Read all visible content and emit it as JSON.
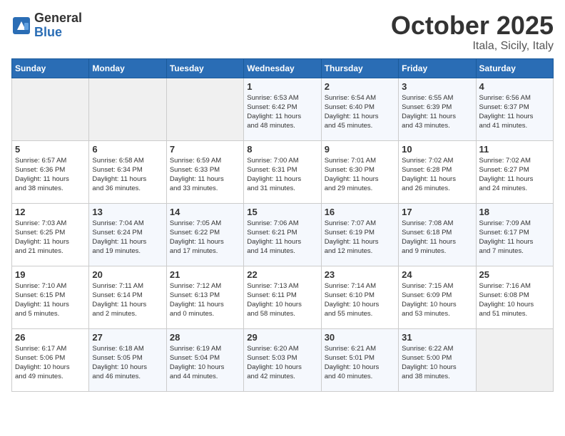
{
  "logo": {
    "general": "General",
    "blue": "Blue"
  },
  "title": "October 2025",
  "subtitle": "Itala, Sicily, Italy",
  "days_header": [
    "Sunday",
    "Monday",
    "Tuesday",
    "Wednesday",
    "Thursday",
    "Friday",
    "Saturday"
  ],
  "weeks": [
    [
      {
        "day": "",
        "info": ""
      },
      {
        "day": "",
        "info": ""
      },
      {
        "day": "",
        "info": ""
      },
      {
        "day": "1",
        "info": "Sunrise: 6:53 AM\nSunset: 6:42 PM\nDaylight: 11 hours\nand 48 minutes."
      },
      {
        "day": "2",
        "info": "Sunrise: 6:54 AM\nSunset: 6:40 PM\nDaylight: 11 hours\nand 45 minutes."
      },
      {
        "day": "3",
        "info": "Sunrise: 6:55 AM\nSunset: 6:39 PM\nDaylight: 11 hours\nand 43 minutes."
      },
      {
        "day": "4",
        "info": "Sunrise: 6:56 AM\nSunset: 6:37 PM\nDaylight: 11 hours\nand 41 minutes."
      }
    ],
    [
      {
        "day": "5",
        "info": "Sunrise: 6:57 AM\nSunset: 6:36 PM\nDaylight: 11 hours\nand 38 minutes."
      },
      {
        "day": "6",
        "info": "Sunrise: 6:58 AM\nSunset: 6:34 PM\nDaylight: 11 hours\nand 36 minutes."
      },
      {
        "day": "7",
        "info": "Sunrise: 6:59 AM\nSunset: 6:33 PM\nDaylight: 11 hours\nand 33 minutes."
      },
      {
        "day": "8",
        "info": "Sunrise: 7:00 AM\nSunset: 6:31 PM\nDaylight: 11 hours\nand 31 minutes."
      },
      {
        "day": "9",
        "info": "Sunrise: 7:01 AM\nSunset: 6:30 PM\nDaylight: 11 hours\nand 29 minutes."
      },
      {
        "day": "10",
        "info": "Sunrise: 7:02 AM\nSunset: 6:28 PM\nDaylight: 11 hours\nand 26 minutes."
      },
      {
        "day": "11",
        "info": "Sunrise: 7:02 AM\nSunset: 6:27 PM\nDaylight: 11 hours\nand 24 minutes."
      }
    ],
    [
      {
        "day": "12",
        "info": "Sunrise: 7:03 AM\nSunset: 6:25 PM\nDaylight: 11 hours\nand 21 minutes."
      },
      {
        "day": "13",
        "info": "Sunrise: 7:04 AM\nSunset: 6:24 PM\nDaylight: 11 hours\nand 19 minutes."
      },
      {
        "day": "14",
        "info": "Sunrise: 7:05 AM\nSunset: 6:22 PM\nDaylight: 11 hours\nand 17 minutes."
      },
      {
        "day": "15",
        "info": "Sunrise: 7:06 AM\nSunset: 6:21 PM\nDaylight: 11 hours\nand 14 minutes."
      },
      {
        "day": "16",
        "info": "Sunrise: 7:07 AM\nSunset: 6:19 PM\nDaylight: 11 hours\nand 12 minutes."
      },
      {
        "day": "17",
        "info": "Sunrise: 7:08 AM\nSunset: 6:18 PM\nDaylight: 11 hours\nand 9 minutes."
      },
      {
        "day": "18",
        "info": "Sunrise: 7:09 AM\nSunset: 6:17 PM\nDaylight: 11 hours\nand 7 minutes."
      }
    ],
    [
      {
        "day": "19",
        "info": "Sunrise: 7:10 AM\nSunset: 6:15 PM\nDaylight: 11 hours\nand 5 minutes."
      },
      {
        "day": "20",
        "info": "Sunrise: 7:11 AM\nSunset: 6:14 PM\nDaylight: 11 hours\nand 2 minutes."
      },
      {
        "day": "21",
        "info": "Sunrise: 7:12 AM\nSunset: 6:13 PM\nDaylight: 11 hours\nand 0 minutes."
      },
      {
        "day": "22",
        "info": "Sunrise: 7:13 AM\nSunset: 6:11 PM\nDaylight: 10 hours\nand 58 minutes."
      },
      {
        "day": "23",
        "info": "Sunrise: 7:14 AM\nSunset: 6:10 PM\nDaylight: 10 hours\nand 55 minutes."
      },
      {
        "day": "24",
        "info": "Sunrise: 7:15 AM\nSunset: 6:09 PM\nDaylight: 10 hours\nand 53 minutes."
      },
      {
        "day": "25",
        "info": "Sunrise: 7:16 AM\nSunset: 6:08 PM\nDaylight: 10 hours\nand 51 minutes."
      }
    ],
    [
      {
        "day": "26",
        "info": "Sunrise: 6:17 AM\nSunset: 5:06 PM\nDaylight: 10 hours\nand 49 minutes."
      },
      {
        "day": "27",
        "info": "Sunrise: 6:18 AM\nSunset: 5:05 PM\nDaylight: 10 hours\nand 46 minutes."
      },
      {
        "day": "28",
        "info": "Sunrise: 6:19 AM\nSunset: 5:04 PM\nDaylight: 10 hours\nand 44 minutes."
      },
      {
        "day": "29",
        "info": "Sunrise: 6:20 AM\nSunset: 5:03 PM\nDaylight: 10 hours\nand 42 minutes."
      },
      {
        "day": "30",
        "info": "Sunrise: 6:21 AM\nSunset: 5:01 PM\nDaylight: 10 hours\nand 40 minutes."
      },
      {
        "day": "31",
        "info": "Sunrise: 6:22 AM\nSunset: 5:00 PM\nDaylight: 10 hours\nand 38 minutes."
      },
      {
        "day": "",
        "info": ""
      }
    ]
  ]
}
